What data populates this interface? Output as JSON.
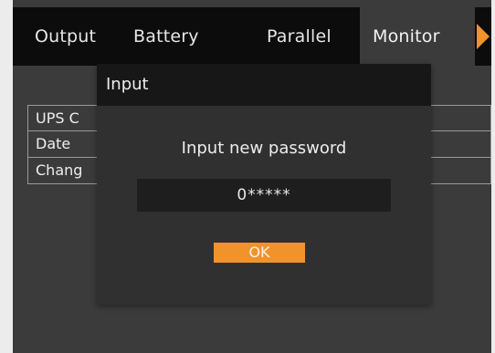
{
  "tabs": [
    {
      "label": "Output"
    },
    {
      "label": "Battery"
    },
    {
      "label": "Parallel"
    },
    {
      "label": "Monitor",
      "active": true
    }
  ],
  "next_tab_icon": "right-arrow-icon",
  "menu": {
    "items": [
      {
        "label": "UPS C"
      },
      {
        "label": "Date"
      },
      {
        "label": "Chang"
      }
    ]
  },
  "dialog": {
    "title": "Input",
    "prompt": "Input new password",
    "password_value": "0*****",
    "ok_label": "OK"
  },
  "colors": {
    "accent": "#f0932b",
    "tab_bar": "#0c0c0c",
    "background": "#3b3b3b"
  }
}
